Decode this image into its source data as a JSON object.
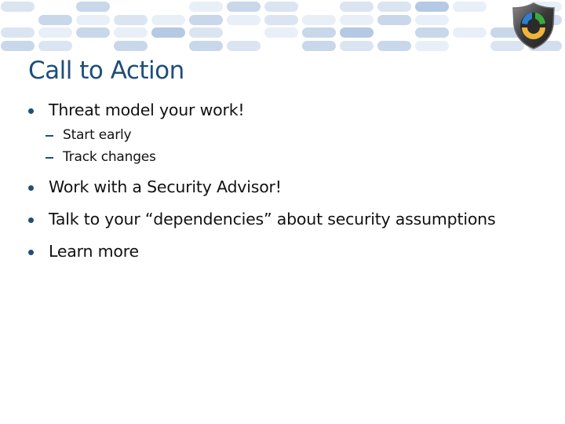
{
  "slide": {
    "title": "Call to Action",
    "logo_icon": "security-shield-icon",
    "colors": {
      "title": "#1f4e79",
      "bullet": "#1f4e79",
      "body_text": "#111111",
      "banner_pills": [
        "#dbe5f1",
        "#c8d7ea",
        "#b4c9e3",
        "#e9eff7",
        "#d2deee"
      ]
    },
    "bullets": [
      {
        "text": "Threat model your work!",
        "sub_bullets": [
          {
            "text": "Start early"
          },
          {
            "text": "Track changes"
          }
        ]
      },
      {
        "text": "Work with a Security Advisor!"
      },
      {
        "text": "Talk to your “dependencies” about security assumptions"
      },
      {
        "text": "Learn more"
      }
    ]
  }
}
